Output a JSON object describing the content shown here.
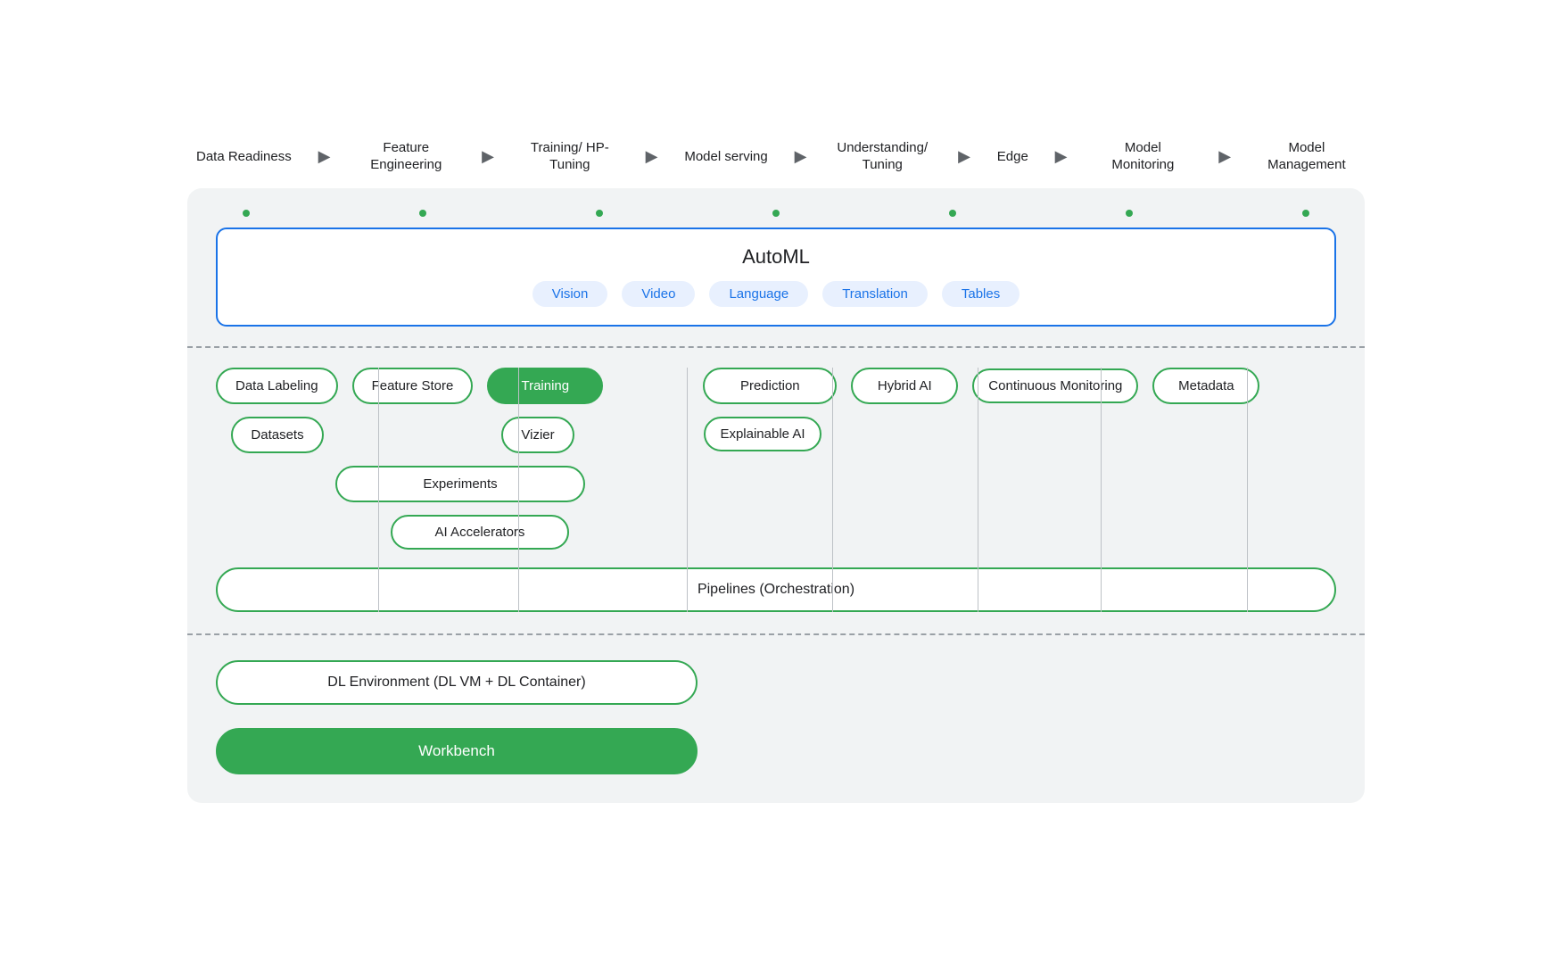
{
  "pipeline": {
    "steps": [
      {
        "label": "Data Readiness"
      },
      {
        "label": "Feature Engineering"
      },
      {
        "label": "Training/ HP-Tuning"
      },
      {
        "label": "Model serving"
      },
      {
        "label": "Understanding/ Tuning"
      },
      {
        "label": "Edge"
      },
      {
        "label": "Model Monitoring"
      },
      {
        "label": "Model Management"
      }
    ]
  },
  "automl": {
    "title": "AutoML",
    "pills": [
      "Vision",
      "Video",
      "Language",
      "Translation",
      "Tables"
    ]
  },
  "items": {
    "row1": [
      {
        "label": "Data Labeling",
        "filled": false
      },
      {
        "label": "Feature Store",
        "filled": false
      },
      {
        "label": "Training",
        "filled": true
      },
      {
        "label": "",
        "filled": false,
        "spacer": true
      },
      {
        "label": "Prediction",
        "filled": false
      },
      {
        "label": "Hybrid AI",
        "filled": false
      },
      {
        "label": "Continuous Monitoring",
        "filled": false
      },
      {
        "label": "Metadata",
        "filled": false
      }
    ],
    "row2": [
      {
        "label": "Datasets",
        "col": 1
      },
      {
        "label": "Vizier",
        "col": 2
      },
      {
        "label": "Explainable AI",
        "col": 4
      }
    ],
    "row3": [
      {
        "label": "Experiments",
        "col": 2
      }
    ],
    "row4": [
      {
        "label": "AI Accelerators",
        "col": 2
      }
    ]
  },
  "pipelines": {
    "label": "Pipelines (Orchestration)"
  },
  "dl_env": {
    "label": "DL Environment (DL VM + DL Container)"
  },
  "workbench": {
    "label": "Workbench"
  }
}
